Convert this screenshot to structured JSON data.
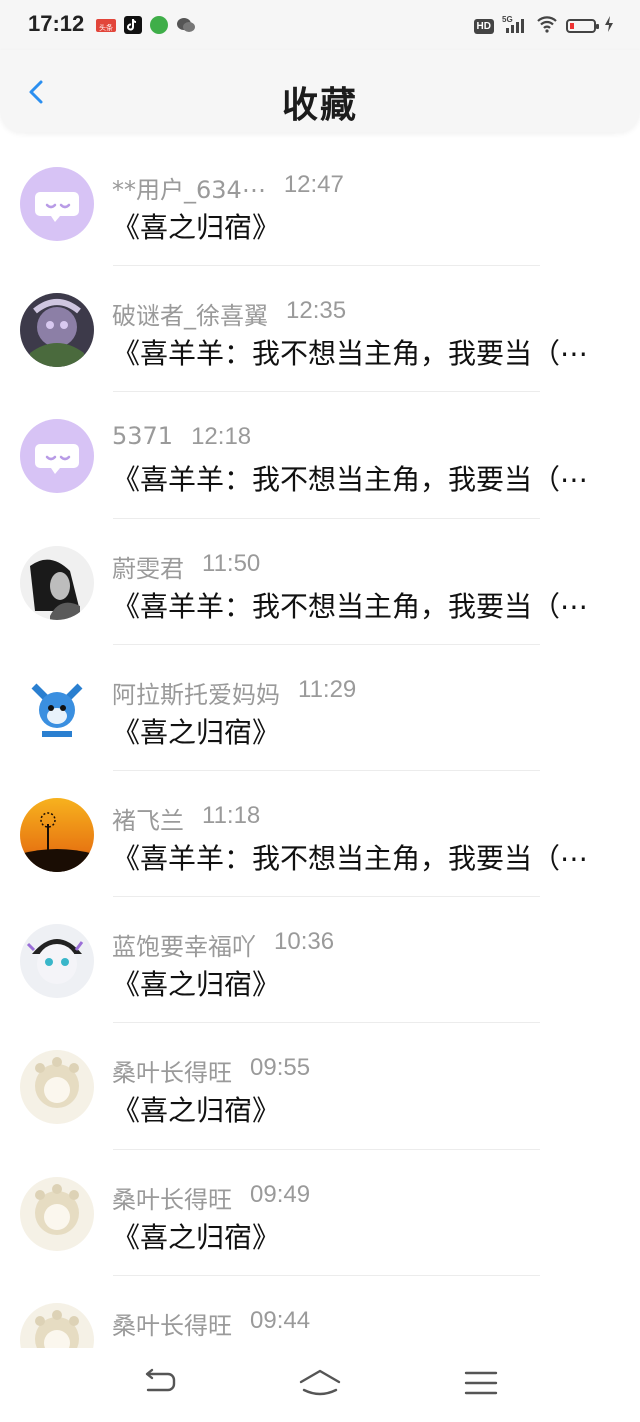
{
  "status_bar": {
    "time": "17:12",
    "news_badge": "头条",
    "network": "5G",
    "hd": "HD"
  },
  "header": {
    "title": "收藏"
  },
  "items": [
    {
      "name": "**用户_634⋯",
      "time": "12:47",
      "title": "《喜之归宿》",
      "avatar": "default-purple"
    },
    {
      "name": "破谜者_徐喜翼",
      "time": "12:35",
      "title": "《喜羊羊：我不想当主角，我要当（⋯",
      "avatar": "anime-dark"
    },
    {
      "name": "5371",
      "time": "12:18",
      "title": "《喜羊羊：我不想当主角，我要当（⋯",
      "avatar": "default-purple"
    },
    {
      "name": "蔚雯君",
      "time": "11:50",
      "title": "《喜羊羊：我不想当主角，我要当（⋯",
      "avatar": "photo-bw"
    },
    {
      "name": "阿拉斯托爱妈妈",
      "time": "11:29",
      "title": "《喜之归宿》",
      "avatar": "anime-blue"
    },
    {
      "name": "褚飞兰",
      "time": "11:18",
      "title": "《喜羊羊：我不想当主角，我要当（⋯",
      "avatar": "sunset"
    },
    {
      "name": "蓝饱要幸福吖",
      "time": "10:36",
      "title": "《喜之归宿》",
      "avatar": "anime-white"
    },
    {
      "name": "桑叶长得旺",
      "time": "09:55",
      "title": "《喜之归宿》",
      "avatar": "anime-cream"
    },
    {
      "name": "桑叶长得旺",
      "time": "09:49",
      "title": "《喜之归宿》",
      "avatar": "anime-cream"
    },
    {
      "name": "桑叶长得旺",
      "time": "09:44",
      "title": "",
      "avatar": "anime-cream"
    }
  ],
  "colors": {
    "accent": "#2b8ff0",
    "default_avatar": "#d7c3f5",
    "meta_text": "#9a9a9a"
  }
}
